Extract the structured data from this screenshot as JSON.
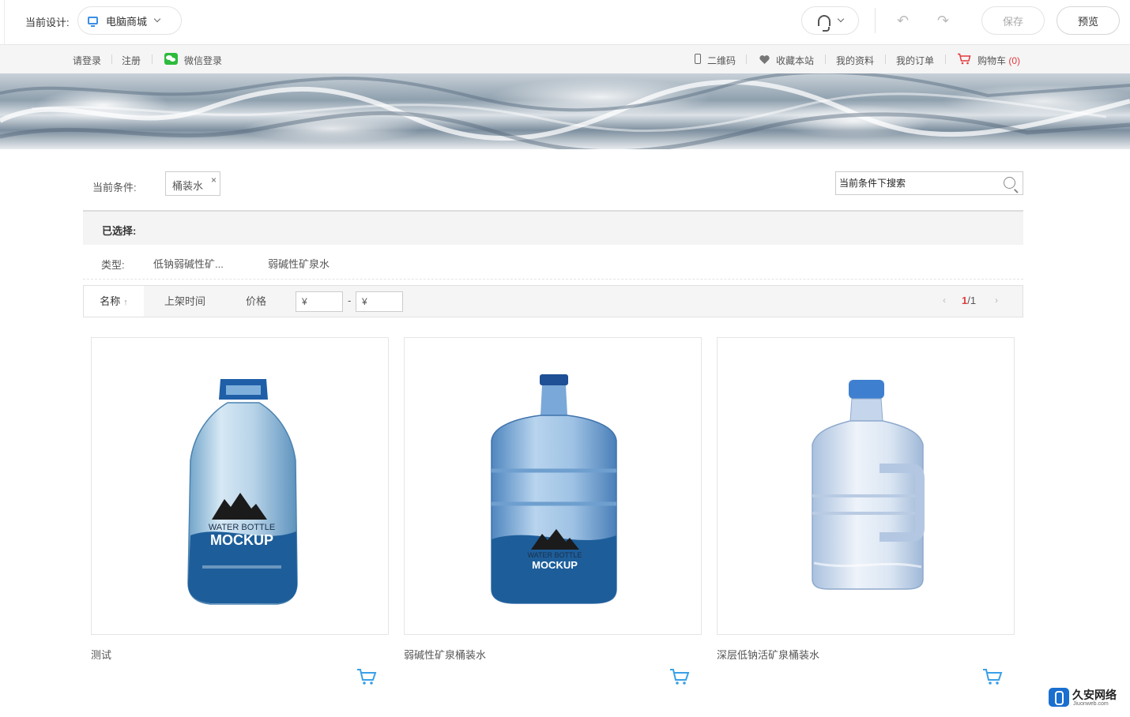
{
  "editor": {
    "design_label": "当前设计:",
    "design_select": "电脑商城",
    "save_label": "保存",
    "preview_label": "预览"
  },
  "top_links": {
    "login": "请登录",
    "register": "注册",
    "wechat_login": "微信登录",
    "qrcode": "二维码",
    "favorite": "收藏本站",
    "my_profile": "我的资料",
    "my_orders": "我的订单",
    "cart": "购物车",
    "cart_count": "(0)"
  },
  "filter": {
    "current_label": "当前条件:",
    "current_tag": "桶装水",
    "search_placeholder": "当前条件下搜索",
    "selected_label": "已选择:",
    "type_label": "类型:",
    "type_options": [
      "低钠弱碱性矿...",
      "弱碱性矿泉水"
    ]
  },
  "sort": {
    "name": "名称",
    "listing_time": "上架时间",
    "price": "价格",
    "price_min_placeholder": "¥",
    "price_max_placeholder": "¥",
    "price_dash": "-",
    "page_current": "1",
    "page_total": "/1"
  },
  "products": [
    {
      "name": "测试"
    },
    {
      "name": "弱碱性矿泉桶装水"
    },
    {
      "name": "深层低钠活矿泉桶装水"
    }
  ],
  "bottle_label": {
    "line1": "WATER BOTTLE",
    "line2": "MOCKUP"
  },
  "watermark": {
    "title": "久安网络",
    "subtitle": "Jiuonweb.com"
  },
  "colors": {
    "accent_blue": "#3a8ee6",
    "price_red": "#e4393c",
    "wechat_green": "#2dbb3c",
    "cart_icon_blue": "#3aa0e8"
  }
}
